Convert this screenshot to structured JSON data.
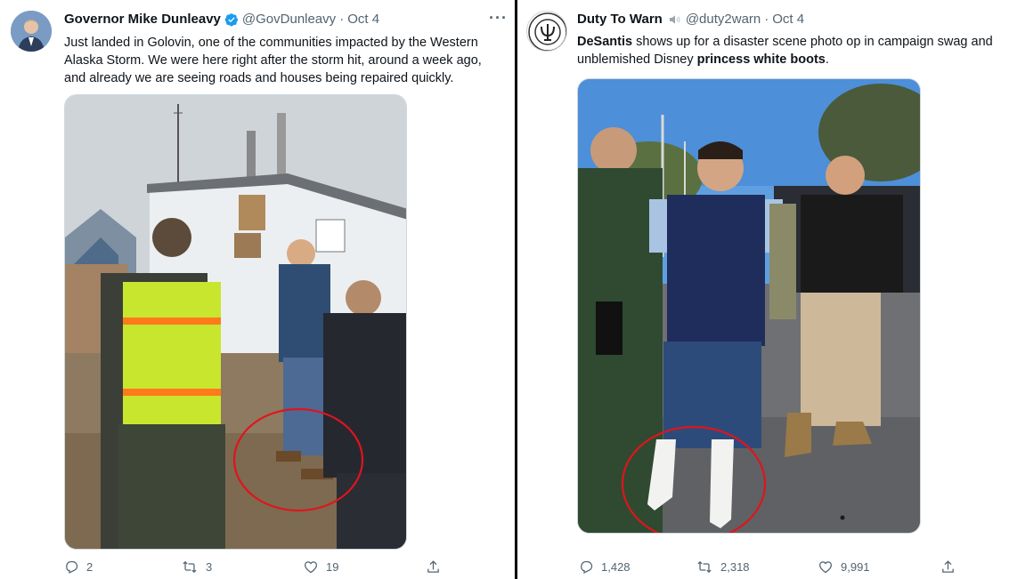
{
  "left_tweet": {
    "name": "Governor Mike Dunleavy",
    "handle": "@GovDunleavy",
    "dot": "·",
    "date": "Oct 4",
    "text": "Just landed in Golovin, one of the communities impacted by the Western Alaska Storm. We were here right after the storm hit, around a week ago, and already we are seeing roads and houses being repaired quickly.",
    "more": "···",
    "replies": "2",
    "retweets": "3",
    "likes": "19",
    "icons": [
      "verified-badge-icon",
      "more-icon",
      "reply-icon",
      "retweet-icon",
      "like-icon",
      "share-icon"
    ]
  },
  "right_tweet": {
    "name": "Duty To Warn",
    "handle": "@duty2warn",
    "dot": "·",
    "date": "Oct 4",
    "text_parts": [
      {
        "t": "DeSantis",
        "bold": true
      },
      {
        "t": " shows up for a disaster scene photo op in campaign swag and unblemished Disney ",
        "bold": false
      },
      {
        "t": "princess white boots",
        "bold": true
      },
      {
        "t": ".",
        "bold": false
      }
    ],
    "replies": "1,428",
    "retweets": "2,318",
    "likes": "9,991",
    "icons": [
      "speaker-icon",
      "reply-icon",
      "retweet-icon",
      "like-icon",
      "share-icon"
    ]
  },
  "colors": {
    "verified": "#1d9bf0",
    "secondary_text": "#536471",
    "annotation_circle": "#e0141c",
    "divider": "#000000"
  }
}
